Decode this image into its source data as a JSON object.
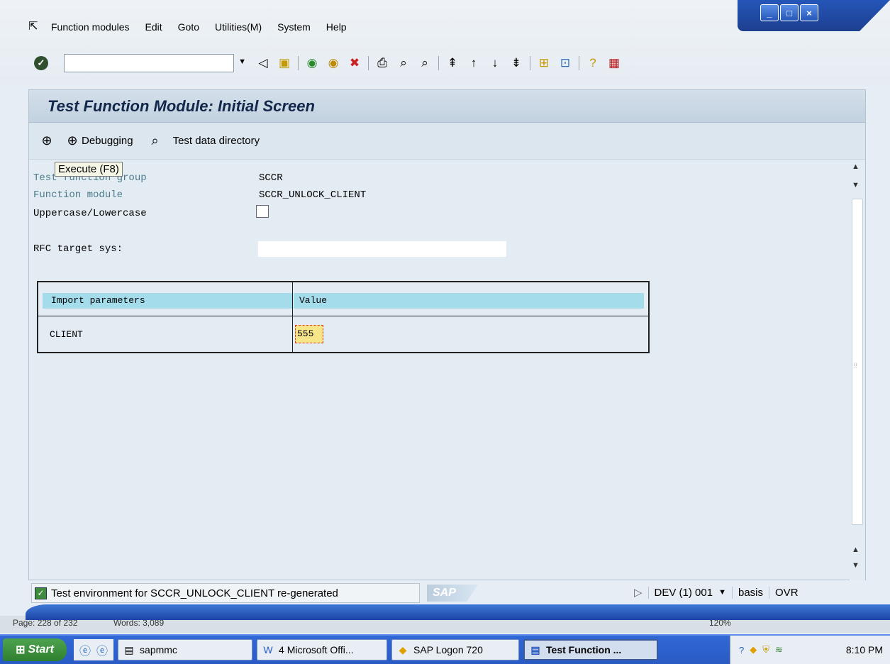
{
  "menu": {
    "items": [
      "Function modules",
      "Edit",
      "Goto",
      "Utilities(M)",
      "System",
      "Help"
    ]
  },
  "window": {
    "min": "_",
    "max": "□",
    "close": "×"
  },
  "page": {
    "title": "Test Function Module: Initial Screen"
  },
  "app_toolbar": {
    "debugging_label": "Debugging",
    "test_data_label": "Test data directory"
  },
  "tooltip": "Execute   (F8)",
  "fields": {
    "function_group_label": "Test function group",
    "function_group_value": "SCCR",
    "function_module_label": "Function module",
    "function_module_value": "SCCR_UNLOCK_CLIENT",
    "uppercase_label": "Uppercase/Lowercase",
    "rfc_label": "RFC target sys:"
  },
  "params_table": {
    "headers": [
      "Import parameters",
      "Value"
    ],
    "rows": [
      {
        "name": "CLIENT",
        "value": "555"
      }
    ]
  },
  "status": {
    "message": "Test environment for SCCR_UNLOCK_CLIENT re-generated",
    "logo": "SAP",
    "system": "DEV (1) 001",
    "user": "basis",
    "mode": "OVR"
  },
  "wordbar": {
    "page": "Page: 228 of 232",
    "words": "Words: 3,089",
    "zoom": "120%"
  },
  "taskbar": {
    "start": "Start",
    "buttons": [
      "sapmmc",
      "4 Microsoft Offi...",
      "SAP Logon 720",
      "Test Function ..."
    ],
    "clock": "8:10 PM"
  }
}
